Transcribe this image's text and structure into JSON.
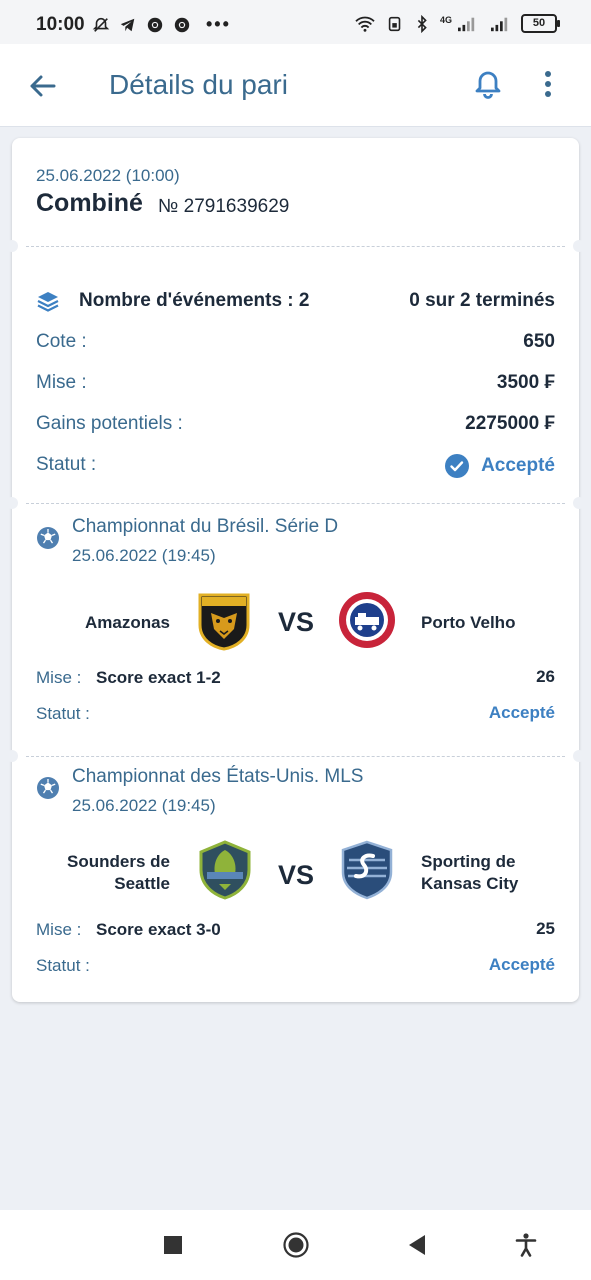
{
  "status_bar": {
    "time": "10:00",
    "battery": "50",
    "network": "4G",
    "left_icons": [
      "muted-notifications-icon",
      "telegram-icon",
      "chrome-icon",
      "chrome-icon",
      "more-dots-icon"
    ],
    "right_icons": [
      "wifi-icon",
      "sim-icon",
      "bluetooth-icon",
      "signal-icon",
      "signal-icon",
      "battery-icon"
    ]
  },
  "app_bar": {
    "title": "Détails du pari",
    "back_icon": "arrow-left-icon",
    "bell_icon": "bell-icon",
    "more_icon": "more-vertical-icon"
  },
  "ticket": {
    "date": "25.06.2022 (10:00)",
    "type": "Combiné",
    "number": "№ 2791639629",
    "events_label": "Nombre d'événements : 2",
    "events_done": "0 sur 2 terminés",
    "rows": [
      {
        "label": "Cote :",
        "value": "650"
      },
      {
        "label": "Mise :",
        "value": "3500 ₣"
      },
      {
        "label": "Gains potentiels :",
        "value": "2275000 ₣"
      }
    ],
    "status_label": "Statut :",
    "status_value": "Accepté"
  },
  "events": [
    {
      "league": "Championnat du Brésil. Série D",
      "date": "25.06.2022 (19:45)",
      "home": "Amazonas",
      "away": "Porto Velho",
      "vs": "VS",
      "mise_label": "Mise :",
      "mise_value": "Score exact 1-2",
      "odd": "26",
      "status_label": "Statut :",
      "status_value": "Accepté",
      "home_logo_text": "AMAZONAS F.C.",
      "away_logo_text": "PORTO VELHO"
    },
    {
      "league": "Championnat des États-Unis. MLS",
      "date": "25.06.2022 (19:45)",
      "home": "Sounders de Seattle",
      "away": "Sporting de Kansas City",
      "vs": "VS",
      "mise_label": "Mise :",
      "mise_value": "Score exact 3-0",
      "odd": "25",
      "status_label": "Statut :",
      "status_value": "Accepté",
      "home_logo_text": "SOUNDERS FC",
      "away_logo_text": "SPORTING"
    }
  ],
  "colors": {
    "accent": "#3d80c2",
    "title": "#3a6a8e",
    "text": "#1d2a3a",
    "background": "#edf0f5"
  },
  "nav_bar": {
    "icons": [
      "recents-square-icon",
      "home-circle-icon",
      "back-triangle-icon",
      "accessibility-icon"
    ]
  }
}
